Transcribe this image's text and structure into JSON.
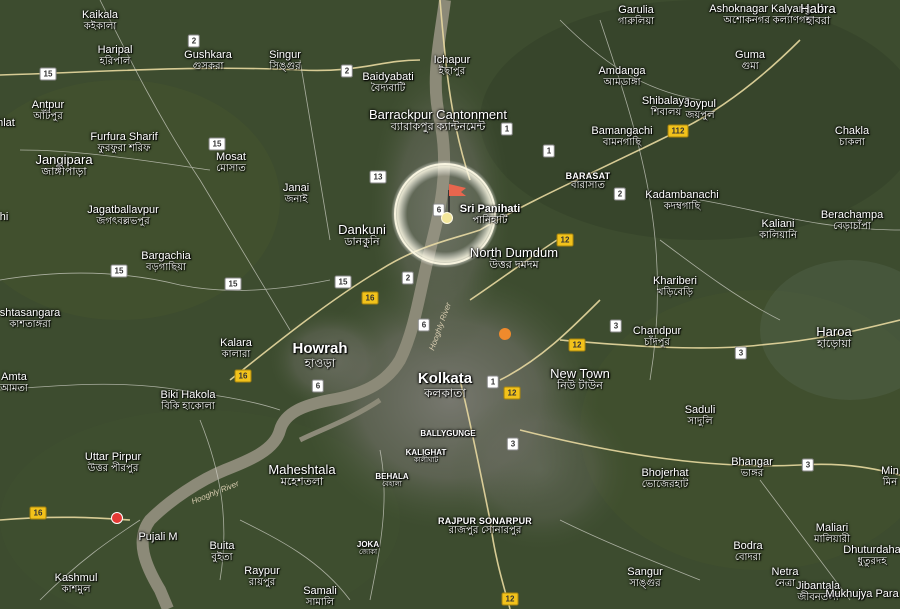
{
  "colors": {
    "land": "#3b4a2e",
    "urban": "#6e6e66",
    "road_major": "#e8d9a0",
    "road_minor": "#d9d9d0",
    "river": "#8c8a78",
    "highlight_ring": "#fffbe6",
    "flag": "#e8664e",
    "red_pin": "#e53935",
    "orange_pin": "#ef8a2c",
    "yellow_pin": "#f3e79b",
    "nh_shield": "#f2c21b",
    "state_shield": "#ffffff"
  },
  "highlight": {
    "name": "Sri Panihati",
    "name_bn": "পানিহাটি",
    "icon": "flag-icon"
  },
  "places": [
    {
      "id": "kaikala",
      "en": "Kaikala",
      "bn": "কইকালা",
      "size": "normal"
    },
    {
      "id": "haripal",
      "en": "Haripal",
      "bn": "হরিপাল",
      "size": "normal"
    },
    {
      "id": "gushkara",
      "en": "Gushkara",
      "bn": "গুসকরা",
      "size": "normal"
    },
    {
      "id": "singur",
      "en": "Singur",
      "bn": "সিঙ্গুর",
      "size": "normal"
    },
    {
      "id": "baidyabati",
      "en": "Baidyabati",
      "bn": "বৈদ্যবাটি",
      "size": "normal"
    },
    {
      "id": "ichapur",
      "en": "Ichapur",
      "bn": "ইছাপুর",
      "size": "normal"
    },
    {
      "id": "garulia",
      "en": "Garulia",
      "bn": "গারুলিয়া",
      "size": "normal"
    },
    {
      "id": "ashoknagar",
      "en": "Ashoknagar Kalyangarh",
      "bn": "অশোকনগর কল্যাণগড়",
      "size": "normal"
    },
    {
      "id": "habra",
      "en": "Habra",
      "bn": "হাবরা",
      "size": "mid"
    },
    {
      "id": "guma",
      "en": "Guma",
      "bn": "গুমা",
      "size": "normal"
    },
    {
      "id": "amdanga",
      "en": "Amdanga",
      "bn": "আমডাঙ্গা",
      "size": "normal"
    },
    {
      "id": "antpur",
      "en": "Antpur",
      "bn": "আঁটপুর",
      "size": "normal"
    },
    {
      "id": "barrackpur",
      "en": "Barrackpur Cantonment",
      "bn": "ব্যারাকপুর ক্যান্টনমেন্ট",
      "size": "mid"
    },
    {
      "id": "shibalaya",
      "en": "Shibalaya",
      "bn": "শিবালয়",
      "size": "normal"
    },
    {
      "id": "joypul",
      "en": "Joypul",
      "bn": "জয়পুল",
      "size": "normal"
    },
    {
      "id": "bamangachi",
      "en": "Bamangachi",
      "bn": "বামনগাছি",
      "size": "normal"
    },
    {
      "id": "chakla",
      "en": "Chakla",
      "bn": "চাকলা",
      "size": "normal"
    },
    {
      "id": "furfura",
      "en": "Furfura Sharif",
      "bn": "ফুরফুরা শরিফ",
      "size": "normal"
    },
    {
      "id": "jangipara",
      "en": "Jangipara",
      "bn": "জাঙ্গীপাড়া",
      "size": "mid"
    },
    {
      "id": "mosat",
      "en": "Mosat",
      "bn": "মোসাত",
      "size": "normal"
    },
    {
      "id": "barasat",
      "en": "BARASAT",
      "bn": "বারাসাত",
      "size": "caps"
    },
    {
      "id": "kadambanachi",
      "en": "Kadambanachi",
      "bn": "কদম্বগাছি",
      "size": "normal"
    },
    {
      "id": "janai",
      "en": "Janai",
      "bn": "জনাই",
      "size": "normal"
    },
    {
      "id": "jagatballavpur",
      "en": "Jagatballavpur",
      "bn": "জগৎবল্লভপুর",
      "size": "normal"
    },
    {
      "id": "dankuni",
      "en": "Dankuni",
      "bn": "ডানকুনি",
      "size": "mid"
    },
    {
      "id": "kaliani",
      "en": "Kaliani",
      "bn": "কালিয়ানি",
      "size": "normal"
    },
    {
      "id": "berachampa",
      "en": "Berachampa",
      "bn": "বেড়াচাঁপা",
      "size": "normal"
    },
    {
      "id": "bargachia",
      "en": "Bargachia",
      "bn": "বড়গাছিয়া",
      "size": "normal"
    },
    {
      "id": "north_dumdum",
      "en": "North Dumdum",
      "bn": "উত্তর দমদম",
      "size": "mid"
    },
    {
      "id": "khariberi",
      "en": "Khariberi",
      "bn": "খড়িবেড়ি",
      "size": "normal"
    },
    {
      "id": "shtasangara",
      "en": "shtasangara",
      "bn": "কাশতাঙ্গরা",
      "size": "normal"
    },
    {
      "id": "kalara",
      "en": "Kalara",
      "bn": "কালারা",
      "size": "normal"
    },
    {
      "id": "howrah",
      "en": "Howrah",
      "bn": "হাওড়া",
      "size": "big"
    },
    {
      "id": "chandpur",
      "en": "Chandpur",
      "bn": "চাঁদপুর",
      "size": "normal"
    },
    {
      "id": "haroa",
      "en": "Haroa",
      "bn": "হাড়োয়া",
      "size": "mid"
    },
    {
      "id": "amta",
      "en": "Amta",
      "bn": "আমতা",
      "size": "normal"
    },
    {
      "id": "kolkata",
      "en": "Kolkata",
      "bn": "কলকাতা",
      "size": "big"
    },
    {
      "id": "new_town",
      "en": "New Town",
      "bn": "নিউ টাউন",
      "size": "mid"
    },
    {
      "id": "bikihakola",
      "en": "Biki Hakola",
      "bn": "বিকি হাকোলা",
      "size": "normal"
    },
    {
      "id": "saduli",
      "en": "Saduli",
      "bn": "সাদুলি",
      "size": "normal"
    },
    {
      "id": "ballygunge",
      "en": "BALLYGUNGE",
      "bn": "",
      "size": "small"
    },
    {
      "id": "kalighat",
      "en": "KALIGHAT",
      "bn": "কালীঘাট",
      "size": "small"
    },
    {
      "id": "maheshtala",
      "en": "Maheshtala",
      "bn": "মহেশতলা",
      "size": "mid"
    },
    {
      "id": "bhangar",
      "en": "Bhangar",
      "bn": "ভাঙ্গর",
      "size": "normal"
    },
    {
      "id": "bhojerhat",
      "en": "Bhojerhat",
      "bn": "ভোজেরহাট",
      "size": "normal"
    },
    {
      "id": "behala",
      "en": "BEHALA",
      "bn": "বেহালা",
      "size": "small"
    },
    {
      "id": "uttar_pirpur",
      "en": "Uttar Pirpur",
      "bn": "উত্তর পীরপুর",
      "size": "normal"
    },
    {
      "id": "pujali",
      "en": "Pujali M",
      "bn": "",
      "size": "normal"
    },
    {
      "id": "rajpur",
      "en": "RAJPUR SONARPUR",
      "bn": "রাজপুর সোনারপুর",
      "size": "caps"
    },
    {
      "id": "joka",
      "en": "JOKA",
      "bn": "জোকা",
      "size": "small"
    },
    {
      "id": "buita",
      "en": "Buita",
      "bn": "বুইতা",
      "size": "normal"
    },
    {
      "id": "maliari",
      "en": "Maliari",
      "bn": "মালিয়ারী",
      "size": "normal"
    },
    {
      "id": "dhuturdaha",
      "en": "Dhuturdaha",
      "bn": "ধুতুরদহ",
      "size": "normal"
    },
    {
      "id": "bodra",
      "en": "Bodra",
      "bn": "বোদরা",
      "size": "normal"
    },
    {
      "id": "sangur",
      "en": "Sangur",
      "bn": "সাঙ্গুর",
      "size": "normal"
    },
    {
      "id": "netra",
      "en": "Netra",
      "bn": "নেত্রা",
      "size": "normal"
    },
    {
      "id": "raypur",
      "en": "Raypur",
      "bn": "রায়পুর",
      "size": "normal"
    },
    {
      "id": "kashmul",
      "en": "Kashmul",
      "bn": "কাশমুল",
      "size": "normal"
    },
    {
      "id": "samali",
      "en": "Samali",
      "bn": "সামালি",
      "size": "normal"
    },
    {
      "id": "jibantala",
      "en": "Jibantala",
      "bn": "জীবনতলা",
      "size": "normal"
    },
    {
      "id": "mukhujya",
      "en": "Mukhujya Para",
      "bn": "",
      "size": "normal"
    },
    {
      "id": "min",
      "en": "Min",
      "bn": "মিন",
      "size": "normal"
    },
    {
      "id": "hlat",
      "en": "hlat",
      "bn": "",
      "size": "normal"
    },
    {
      "id": "hi",
      "en": "hi",
      "bn": "",
      "size": "normal"
    }
  ],
  "route_shields": [
    {
      "id": "s2a",
      "label": "2",
      "kind": "state"
    },
    {
      "id": "s2b",
      "label": "2",
      "kind": "state"
    },
    {
      "id": "s15a",
      "label": "15",
      "kind": "state"
    },
    {
      "id": "s15b",
      "label": "15",
      "kind": "state"
    },
    {
      "id": "s15c",
      "label": "15",
      "kind": "state"
    },
    {
      "id": "s15d",
      "label": "15",
      "kind": "state"
    },
    {
      "id": "s15e",
      "label": "15",
      "kind": "state"
    },
    {
      "id": "s13",
      "label": "13",
      "kind": "state"
    },
    {
      "id": "s1a",
      "label": "1",
      "kind": "state"
    },
    {
      "id": "s1b",
      "label": "1",
      "kind": "state"
    },
    {
      "id": "s1c",
      "label": "1",
      "kind": "state"
    },
    {
      "id": "s2c",
      "label": "2",
      "kind": "state"
    },
    {
      "id": "s2d",
      "label": "2",
      "kind": "state"
    },
    {
      "id": "s6a",
      "label": "6",
      "kind": "state"
    },
    {
      "id": "s6b",
      "label": "6",
      "kind": "state"
    },
    {
      "id": "s6c",
      "label": "6",
      "kind": "state"
    },
    {
      "id": "s3a",
      "label": "3",
      "kind": "state"
    },
    {
      "id": "s3b",
      "label": "3",
      "kind": "state"
    },
    {
      "id": "s3c",
      "label": "3",
      "kind": "state"
    },
    {
      "id": "s3d",
      "label": "3",
      "kind": "state"
    },
    {
      "id": "n112",
      "label": "112",
      "kind": "nh"
    },
    {
      "id": "n12a",
      "label": "12",
      "kind": "nh"
    },
    {
      "id": "n12b",
      "label": "12",
      "kind": "nh"
    },
    {
      "id": "n12c",
      "label": "12",
      "kind": "nh"
    },
    {
      "id": "n12d",
      "label": "12",
      "kind": "nh"
    },
    {
      "id": "n16a",
      "label": "16",
      "kind": "nh"
    },
    {
      "id": "n16b",
      "label": "16",
      "kind": "nh"
    },
    {
      "id": "n16c",
      "label": "16",
      "kind": "nh"
    }
  ],
  "rivers": [
    {
      "id": "hooghly_south",
      "label": "Hooghly River"
    },
    {
      "id": "hooghly_north",
      "label": "Hooghly River"
    }
  ],
  "pins": [
    {
      "id": "red",
      "icon": "red-pin-icon"
    },
    {
      "id": "orange",
      "icon": "orange-pin-icon"
    },
    {
      "id": "yellow",
      "icon": "yellow-pin-icon"
    }
  ]
}
